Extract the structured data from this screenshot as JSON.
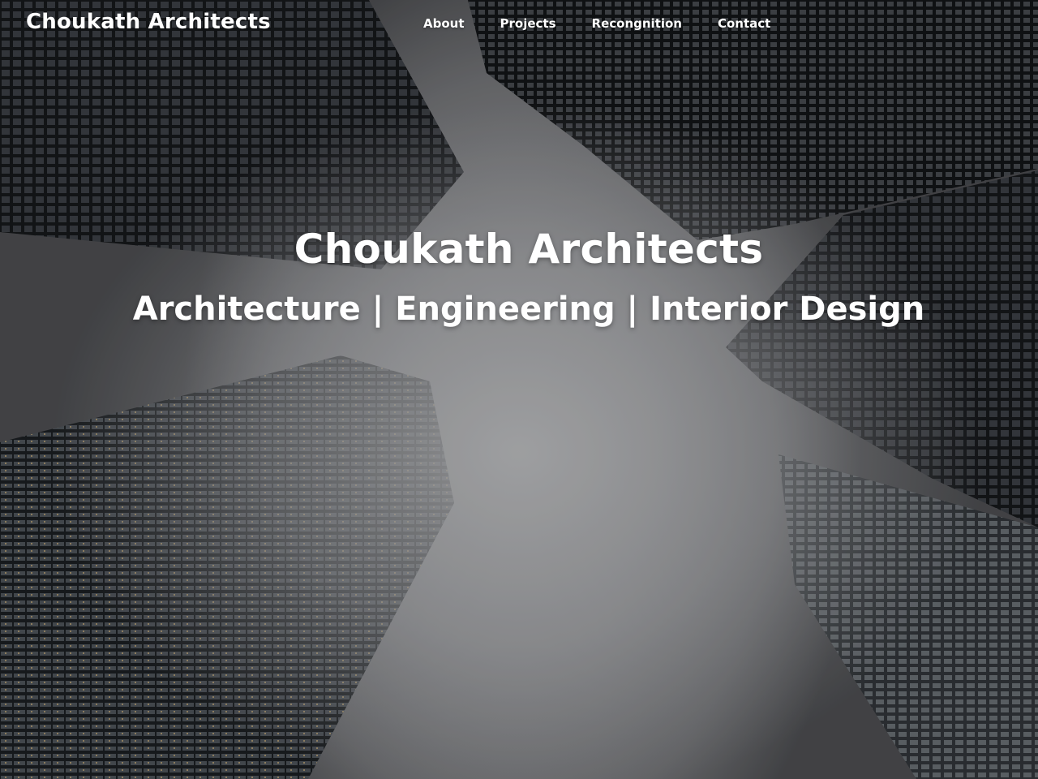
{
  "navbar": {
    "brand": "Choukath Architects",
    "links": [
      {
        "label": "About"
      },
      {
        "label": "Projects"
      },
      {
        "label": "Recongnition"
      },
      {
        "label": "Contact"
      }
    ]
  },
  "hero": {
    "title": "Choukath Architects",
    "subtitle": "Architecture | Engineering | Interior Design",
    "background": "low-angle photo of glass skyscrapers in fog"
  },
  "colors": {
    "text": "#ffffff",
    "sky": "#8f9093",
    "building": "#1e2022"
  }
}
